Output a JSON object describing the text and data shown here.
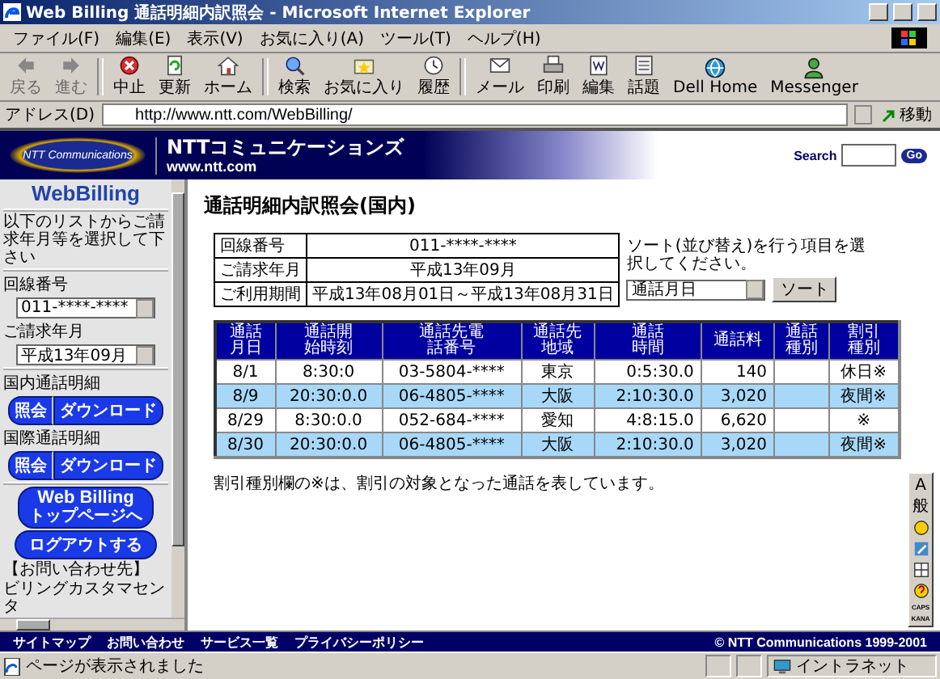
{
  "window": {
    "title": "Web Billing 通話明細内訳照会 - Microsoft Internet Explorer"
  },
  "menu": [
    "ファイル(F)",
    "編集(E)",
    "表示(V)",
    "お気に入り(A)",
    "ツール(T)",
    "ヘルプ(H)"
  ],
  "toolbar": [
    {
      "label": "戻る",
      "disabled": true
    },
    {
      "label": "進む",
      "disabled": true
    },
    {
      "label": "中止",
      "disabled": false
    },
    {
      "label": "更新",
      "disabled": false
    },
    {
      "label": "ホーム",
      "disabled": false
    },
    {
      "label": "検索",
      "disabled": false
    },
    {
      "label": "お気に入り",
      "disabled": false
    },
    {
      "label": "履歴",
      "disabled": false
    },
    {
      "label": "メール",
      "disabled": false
    },
    {
      "label": "印刷",
      "disabled": false
    },
    {
      "label": "編集",
      "disabled": false
    },
    {
      "label": "話題",
      "disabled": false
    },
    {
      "label": "Dell Home",
      "disabled": false
    },
    {
      "label": "Messenger",
      "disabled": false
    }
  ],
  "address": {
    "label": "アドレス(D)",
    "value": "http://www.ntt.com/WebBilling/",
    "go": "移動"
  },
  "header": {
    "logo": "NTT Communications",
    "brand": "NTTコミュニケーションズ",
    "url": "www.ntt.com",
    "search_label": "Search",
    "search_button": "Go"
  },
  "sidebar": {
    "logo": "WebBilling",
    "instruction": "以下のリストからご請求年月等を選択して下さい",
    "line_number": {
      "label": "回線番号",
      "value": "011-****-****"
    },
    "billing_month": {
      "label": "ご請求年月",
      "value": "平成13年09月"
    },
    "sections": [
      {
        "label": "国内通話明細",
        "buttons": [
          "照会",
          "ダウンロード"
        ]
      },
      {
        "label": "国際通話明細",
        "buttons": [
          "照会",
          "ダウンロード"
        ]
      }
    ],
    "top_button": [
      "Web Billing",
      "トップページへ"
    ],
    "logout": "ログアウトする",
    "contact": [
      "【お問い合わせ先】",
      "ビリングカスタマセンタ"
    ]
  },
  "main": {
    "title": "通話明細内訳照会(国内)",
    "info": [
      {
        "label": "回線番号",
        "value": "011-****-****"
      },
      {
        "label": "ご請求年月",
        "value": "平成13年09月"
      },
      {
        "label": "ご利用期間",
        "value": "平成13年08月01日～平成13年08月31日"
      }
    ],
    "sort": {
      "instruction": "ソート(並び替え)を行う項目を選択してください。",
      "value": "通話月日",
      "button": "ソート"
    },
    "table": {
      "columns": [
        "通話月日",
        "通話開始時刻",
        "通話先電話番号",
        "通話先地域",
        "通話時間",
        "通話料",
        "通話種別",
        "割引種別"
      ],
      "rows": [
        [
          "8/1",
          "8:30:0",
          "03-5804-****",
          "東京",
          "0:5:30.0",
          "140",
          "",
          "休日※"
        ],
        [
          "8/9",
          "20:30:0.0",
          "06-4805-****",
          "大阪",
          "2:10:30.0",
          "3,020",
          "",
          "夜間※"
        ],
        [
          "8/29",
          "8:30:0.0",
          "052-684-****",
          "愛知",
          "4:8:15.0",
          "6,620",
          "",
          "※"
        ],
        [
          "8/30",
          "20:30:0.0",
          "06-4805-****",
          "大阪",
          "2:10:30.0",
          "3,020",
          "",
          "夜間※"
        ]
      ]
    },
    "note": "割引種別欄の※は、割引の対象となった通話を表しています。"
  },
  "ime_bar": {
    "mode": "A",
    "dictionary": "般",
    "caps": "CAPS",
    "kana": "KANA"
  },
  "footer": {
    "links": [
      "サイトマップ",
      "お問い合わせ",
      "サービス一覧",
      "プライバシーポリシー"
    ],
    "copyright": "© NTT Communications 1999-2001"
  },
  "status_bar": {
    "text": "ページが表示されました",
    "zone": "イントラネット"
  }
}
